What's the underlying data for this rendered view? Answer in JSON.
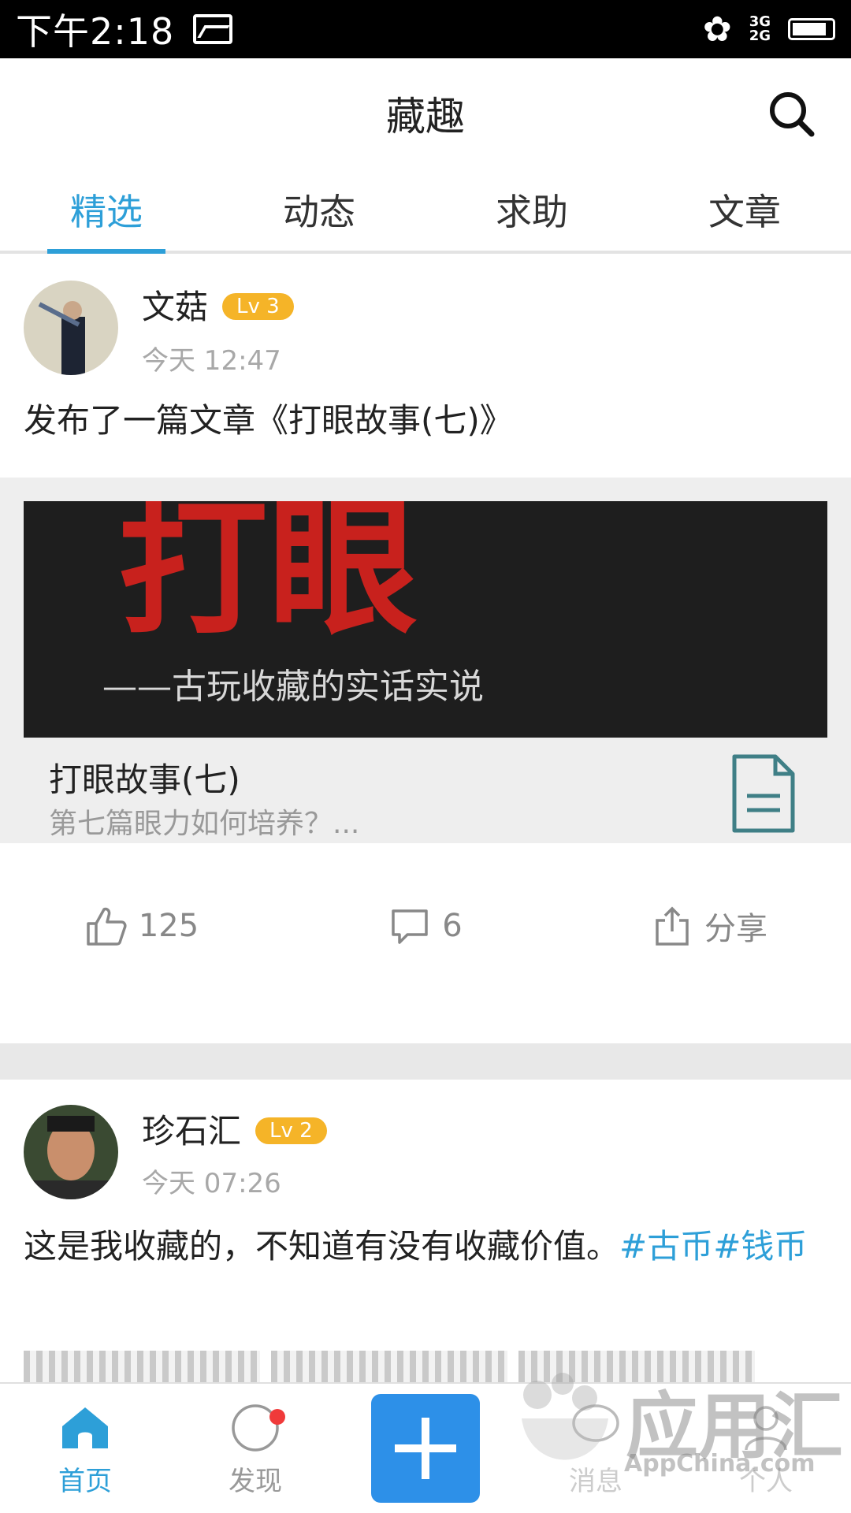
{
  "status_bar": {
    "time": "下午2:18",
    "signal": "3G\n2G"
  },
  "header": {
    "title": "藏趣"
  },
  "tabs": [
    {
      "label": "精选"
    },
    {
      "label": "动态"
    },
    {
      "label": "求助"
    },
    {
      "label": "文章"
    }
  ],
  "posts": [
    {
      "username": "文菇",
      "level": "Lv 3",
      "time": "今天 12:47",
      "text": "发布了一篇文章《打眼故事(七)》",
      "article": {
        "banner_big": "打眼",
        "banner_sub": "——古玩收藏的实话实说",
        "title": "打眼故事(七)",
        "desc": "第七篇眼力如何培养？..."
      },
      "likes": "125",
      "comments": "6",
      "share": "分享"
    },
    {
      "username": "珍石汇",
      "level": "Lv 2",
      "time": "今天 07:26",
      "text": "这是我收藏的，不知道有没有收藏价值。",
      "hashtag": "#古币#钱币"
    }
  ],
  "bottom_nav": [
    {
      "label": "首页"
    },
    {
      "label": "发现"
    },
    {
      "label": ""
    },
    {
      "label": "消息"
    },
    {
      "label": "个人"
    }
  ],
  "watermark": {
    "text": "应用汇",
    "sub": "AppChina.com"
  },
  "colors": {
    "accent": "#2d9fd8",
    "level_badge": "#f5b428",
    "plus_button": "#2d90e8"
  }
}
